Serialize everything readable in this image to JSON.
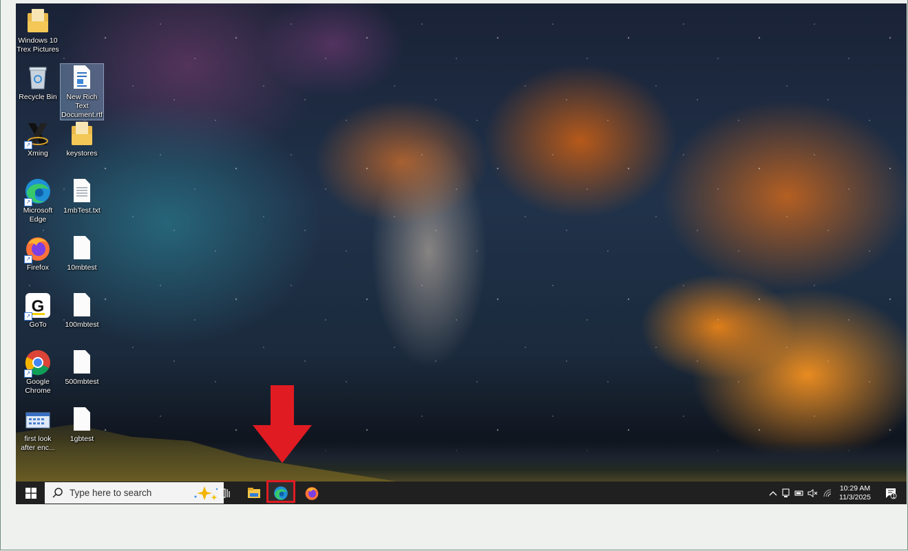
{
  "desktop": {
    "icons": [
      {
        "label": "Windows 10 Trex Pictures",
        "icon": "folder-icon"
      },
      {
        "label": "Recycle Bin",
        "icon": "recycle-bin-icon"
      },
      {
        "label": "New Rich Text Document.rtf",
        "icon": "rtf-document-icon"
      },
      {
        "label": "Xming",
        "icon": "xming-icon"
      },
      {
        "label": "keystores",
        "icon": "folder-icon"
      },
      {
        "label": "Microsoft Edge",
        "icon": "edge-icon"
      },
      {
        "label": "1mbTest.txt",
        "icon": "text-file-icon"
      },
      {
        "label": "Firefox",
        "icon": "firefox-icon"
      },
      {
        "label": "10mbtest",
        "icon": "file-icon"
      },
      {
        "label": "GoTo",
        "icon": "goto-icon"
      },
      {
        "label": "100mbtest",
        "icon": "file-icon"
      },
      {
        "label": "Google Chrome",
        "icon": "chrome-icon"
      },
      {
        "label": "500mbtest",
        "icon": "file-icon"
      },
      {
        "label": "first look after enc...",
        "icon": "image-icon"
      },
      {
        "label": "1gbtest",
        "icon": "file-icon"
      }
    ]
  },
  "taskbar": {
    "search_placeholder": "Type here to search",
    "pinned": [
      "file-explorer-icon",
      "edge-icon",
      "firefox-icon"
    ],
    "tray": {
      "time": "10:29 AM",
      "date": "11/3/2025",
      "notification_count": "1"
    }
  },
  "annotation": {
    "highlight_color": "#e11b22",
    "target": "edge-taskbar-button"
  }
}
